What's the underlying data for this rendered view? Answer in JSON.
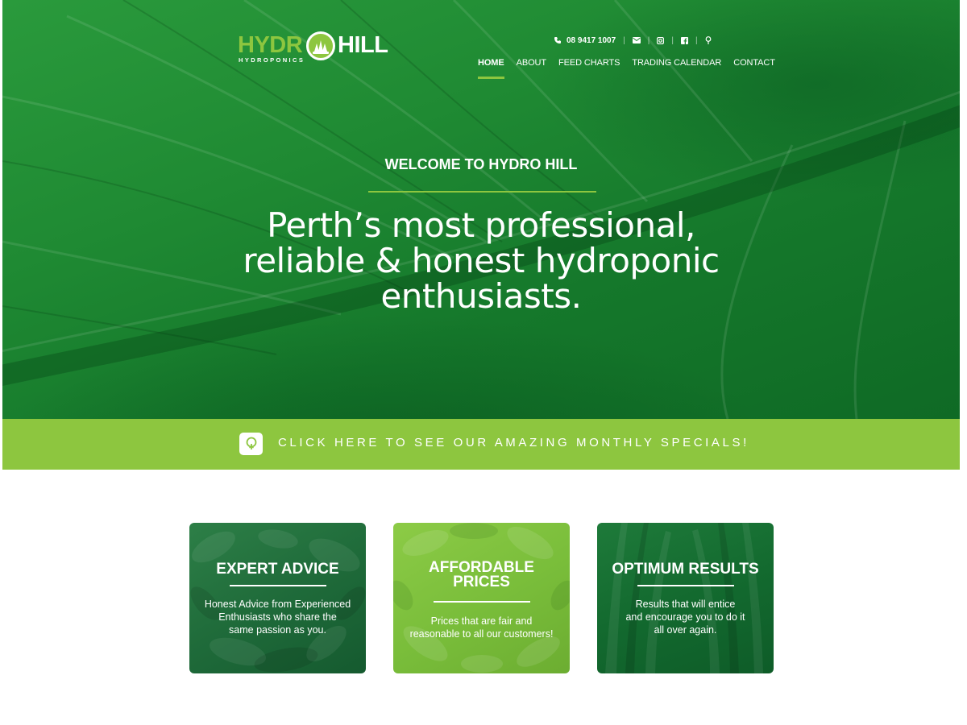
{
  "brand": {
    "word1": "HYDR",
    "word2": "HILL",
    "tagline": "HYDROPONICS",
    "logo_icon": "trees-circle-logo"
  },
  "topbar": {
    "phone": "08 9417 1007",
    "icons": [
      "phone-icon",
      "email-icon",
      "instagram-icon",
      "facebook-icon",
      "location-pin-icon"
    ]
  },
  "nav": {
    "items": [
      {
        "label": "HOME",
        "active": true
      },
      {
        "label": "ABOUT",
        "active": false
      },
      {
        "label": "FEED CHARTS",
        "active": false
      },
      {
        "label": "TRADING CALENDAR",
        "active": false
      },
      {
        "label": "CONTACT",
        "active": false
      }
    ]
  },
  "hero": {
    "welcome": "WELCOME TO HYDRO HILL",
    "headline_line1": "Perth’s most professional,",
    "headline_line2": "reliable & honest hydroponic",
    "headline_line3": "enthusiasts."
  },
  "specials": {
    "label": "CLICK HERE TO SEE OUR AMAZING MONTHLY SPECIALS!",
    "icon": "tree-icon"
  },
  "cards": [
    {
      "title": "EXPERT ADVICE",
      "text_line1": "Honest Advice from Experienced",
      "text_line2": "Enthusiasts who share the",
      "text_line3": "same passion as you."
    },
    {
      "title_line1": "AFFORDABLE",
      "title_line2": "PRICES",
      "text_line1": "Prices that are fair and",
      "text_line2": "reasonable to all our customers!"
    },
    {
      "title": "OPTIMUM RESULTS",
      "text_line1": "Results that will entice",
      "text_line2": "and encourage you to do it",
      "text_line3": "all over again."
    }
  ],
  "colors": {
    "accent_green": "#8dc63f",
    "hero_green": "#1f8a33",
    "white": "#ffffff"
  }
}
